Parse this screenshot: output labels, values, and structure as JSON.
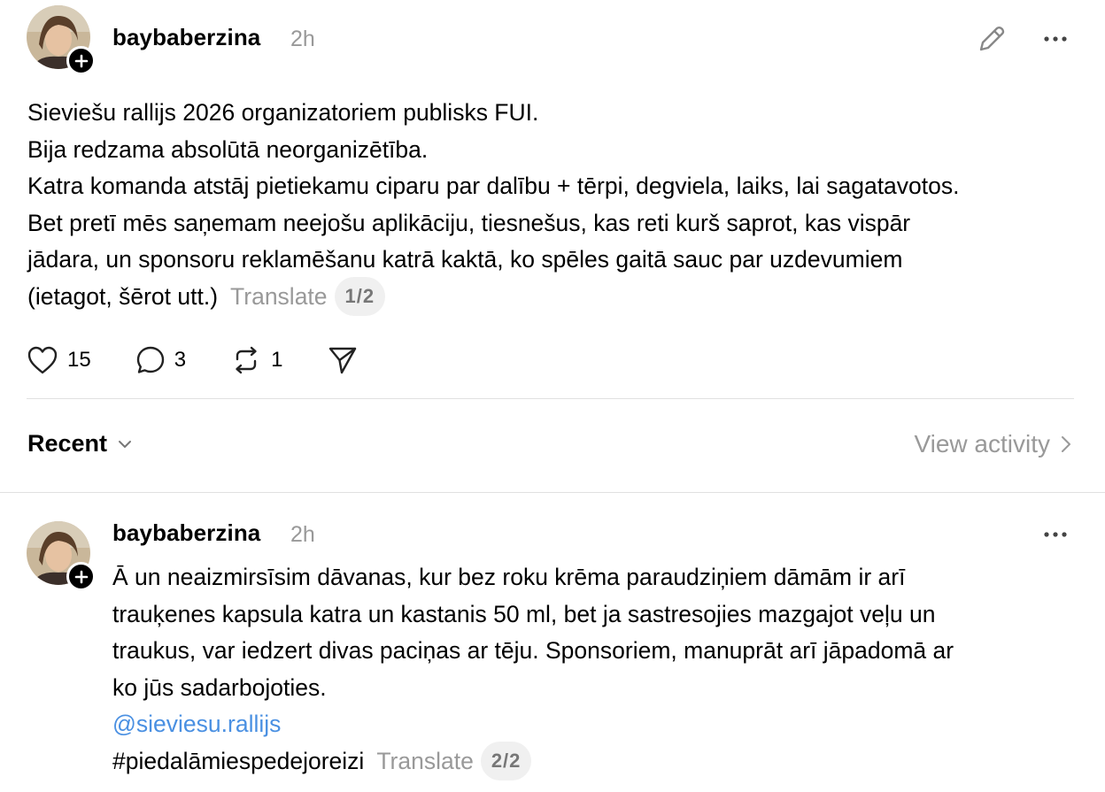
{
  "post1": {
    "username": "baybaberzina",
    "time": "2h",
    "lines": [
      "Sieviešu rallijs 2026 organizatoriem publisks FUI.",
      "Bija redzama absolūtā neorganizētība.",
      "Katra komanda atstāj pietiekamu ciparu par dalību + tērpi, degviela, laiks, lai sagatavotos.",
      "Bet pretī mēs saņemam neejošu aplikāciju, tiesnešus, kas reti kurš saprot, kas vispār",
      "jādara, un sponsoru reklamēšanu katrā kaktā, ko spēles gaitā sauc par uzdevumiem",
      "(ietagot, šērot utt.)"
    ],
    "translate_label": "Translate",
    "page_indicator": "1/2",
    "likes": "15",
    "replies": "3",
    "reposts": "1"
  },
  "feed": {
    "sort_label": "Recent",
    "view_activity_label": "View activity"
  },
  "post2": {
    "username": "baybaberzina",
    "time": "2h",
    "lines": [
      "Ā un neaizmirsīsim dāvanas, kur bez roku krēma paraudziņiem dāmām ir arī",
      "trauķenes kapsula katra un kastanis 50 ml, bet ja sastresojies mazgajot veļu un",
      "traukus, var iedzert divas paciņas ar tēju. Sponsoriem, manuprāt arī jāpadomā ar",
      "ko jūs sadarbojoties."
    ],
    "mention": "@sieviesu.rallijs",
    "hashtag": "#piedalāmiespedejoreizi",
    "translate_label": "Translate",
    "page_indicator": "2/2"
  },
  "icons": {
    "edit": "pencil-icon",
    "more": "more-horizontal-icon",
    "like": "heart-icon",
    "reply": "comment-bubble-icon",
    "repost": "repost-arrows-icon",
    "share": "send-paper-plane-icon",
    "follow": "plus-icon",
    "sort": "chevron-down-icon",
    "activity": "chevron-right-icon"
  }
}
